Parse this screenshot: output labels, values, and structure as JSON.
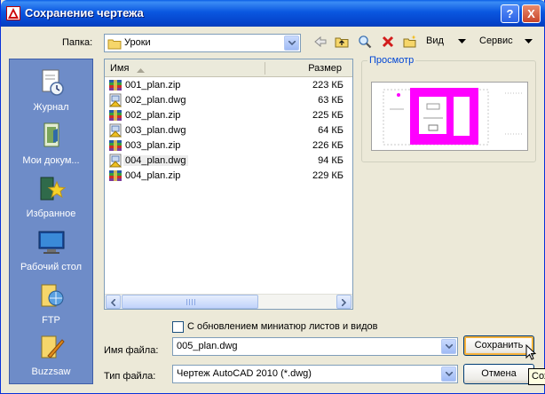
{
  "window": {
    "title": "Сохранение чертежа",
    "close_glyph": "X"
  },
  "folder": {
    "label": "Папка:",
    "value": "Уроки"
  },
  "toolbar": {
    "view_label": "Вид",
    "service_label": "Сервис"
  },
  "places": [
    {
      "label": "Журнал",
      "icon": "history-icon"
    },
    {
      "label": "Мои докум...",
      "icon": "my-documents-icon"
    },
    {
      "label": "Избранное",
      "icon": "favorites-icon"
    },
    {
      "label": "Рабочий стол",
      "icon": "desktop-icon"
    },
    {
      "label": "FTP",
      "icon": "ftp-icon"
    },
    {
      "label": "Buzzsaw",
      "icon": "buzzsaw-icon"
    }
  ],
  "list": {
    "col_name": "Имя",
    "col_size": "Размер",
    "files": [
      {
        "name": "001_plan.zip",
        "size": "223 КБ",
        "kind": "zip"
      },
      {
        "name": "002_plan.dwg",
        "size": "63 КБ",
        "kind": "dwg"
      },
      {
        "name": "002_plan.zip",
        "size": "225 КБ",
        "kind": "zip"
      },
      {
        "name": "003_plan.dwg",
        "size": "64 КБ",
        "kind": "dwg"
      },
      {
        "name": "003_plan.zip",
        "size": "226 КБ",
        "kind": "zip"
      },
      {
        "name": "004_plan.dwg",
        "size": "94 КБ",
        "kind": "dwg",
        "selected": true
      },
      {
        "name": "004_plan.zip",
        "size": "229 КБ",
        "kind": "zip"
      }
    ]
  },
  "preview": {
    "label": "Просмотр"
  },
  "options": {
    "update_thumbnails_label": "С обновлением миниатюр листов и видов",
    "update_thumbnails_checked": false
  },
  "filename": {
    "label": "Имя файла:",
    "value": "005_plan.dwg"
  },
  "filetype": {
    "label": "Тип файла:",
    "value": "Чертеж AutoCAD 2010 (*.dwg)"
  },
  "buttons": {
    "save": "Сохранить",
    "cancel": "Отмена"
  },
  "tooltip": {
    "text": "Сохр"
  },
  "colors": {
    "titlebar": "#0a57e0",
    "places_panel": "#6e8cc8",
    "preview_highlight": "#ff00ff",
    "default_button_focus": "#f8b33c"
  }
}
